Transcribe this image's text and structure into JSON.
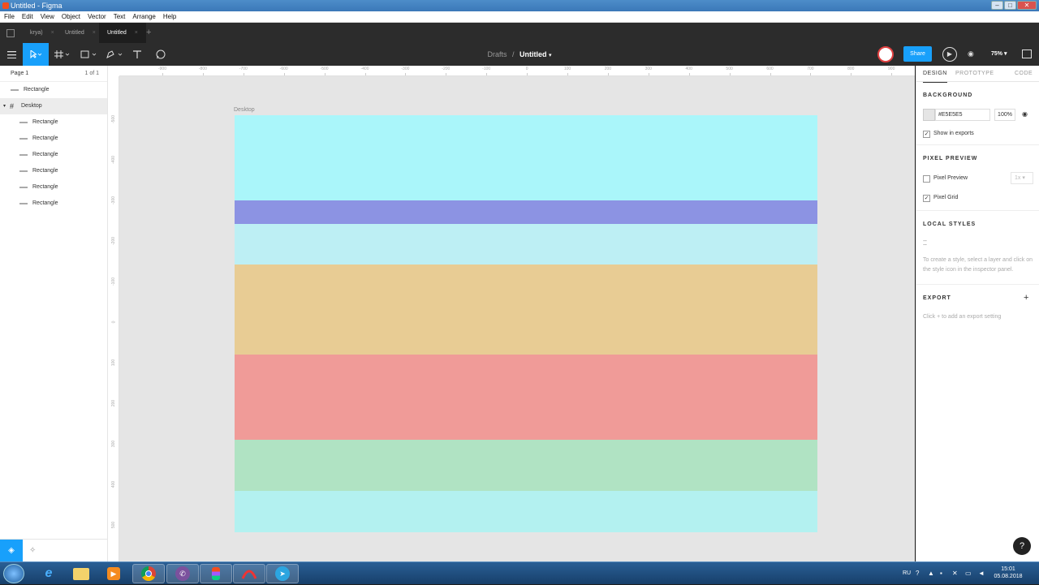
{
  "window": {
    "title": "Untitled - Figma"
  },
  "menu": [
    "File",
    "Edit",
    "View",
    "Object",
    "Vector",
    "Text",
    "Arrange",
    "Help"
  ],
  "tabs": [
    {
      "label": "krya)",
      "active": false
    },
    {
      "label": "Untitled",
      "active": false
    },
    {
      "label": "Untitled",
      "active": true
    }
  ],
  "toolbar": {
    "breadcrumb_folder": "Drafts",
    "breadcrumb_sep": "/",
    "file_name": "Untitled",
    "share_label": "Share",
    "zoom": "75%"
  },
  "layers": {
    "page_name": "Page 1",
    "page_count": "1 of 1",
    "items": [
      {
        "name": "Rectangle",
        "depth": 0,
        "type": "rect"
      },
      {
        "name": "Desktop",
        "depth": 0,
        "type": "frame",
        "selected": true
      },
      {
        "name": "Rectangle",
        "depth": 1,
        "type": "rect"
      },
      {
        "name": "Rectangle",
        "depth": 1,
        "type": "rect"
      },
      {
        "name": "Rectangle",
        "depth": 1,
        "type": "rect"
      },
      {
        "name": "Rectangle",
        "depth": 1,
        "type": "rect"
      },
      {
        "name": "Rectangle",
        "depth": 1,
        "type": "rect"
      },
      {
        "name": "Rectangle",
        "depth": 1,
        "type": "rect"
      }
    ]
  },
  "rulers": {
    "x_ticks": [
      "-900",
      "-800",
      "-700",
      "-600",
      "-500",
      "-400",
      "-300",
      "-200",
      "-100",
      "0",
      "100",
      "200",
      "300",
      "400",
      "500",
      "600",
      "700",
      "800",
      "900"
    ],
    "y_ticks": [
      "-500",
      "-400",
      "-300",
      "-200",
      "-100",
      "0",
      "100",
      "200",
      "300",
      "400",
      "500"
    ]
  },
  "canvas": {
    "frame_label": "Desktop",
    "bands": [
      {
        "color": "#aaf6fa",
        "weight": 105
      },
      {
        "color": "#8c93e3",
        "weight": 29
      },
      {
        "color": "#bdeff4",
        "weight": 50
      },
      {
        "color": "#e8cc94",
        "weight": 111
      },
      {
        "color": "#f09b98",
        "weight": 105
      },
      {
        "color": "#b0e3c3",
        "weight": 63
      },
      {
        "color": "#b3f1f0",
        "weight": 51
      }
    ]
  },
  "inspector": {
    "tabs": [
      "DESIGN",
      "PROTOTYPE",
      "CODE"
    ],
    "background_title": "BACKGROUND",
    "bg_hex": "#E5E5E5",
    "bg_opacity": "100%",
    "show_in_exports": "Show in exports",
    "pixel_preview_title": "PIXEL PREVIEW",
    "pixel_preview_label": "Pixel Preview",
    "pixel_preview_scale": "1x",
    "pixel_grid_label": "Pixel Grid",
    "local_styles_title": "LOCAL STYLES",
    "local_styles_hint": "To create a style, select a layer and click on the style icon in the inspector panel.",
    "export_title": "EXPORT",
    "export_hint": "Click + to add an export setting"
  },
  "help_label": "?",
  "taskbar": {
    "lang": "RU",
    "time": "15:01",
    "date": "05.08.2018",
    "apps": [
      "internet-explorer",
      "file-explorer",
      "media-player",
      "chrome",
      "viber",
      "figma",
      "app-red-arc",
      "telegram"
    ]
  },
  "colors": {
    "accent": "#18a0fb",
    "toolbar": "#2c2c2c"
  }
}
